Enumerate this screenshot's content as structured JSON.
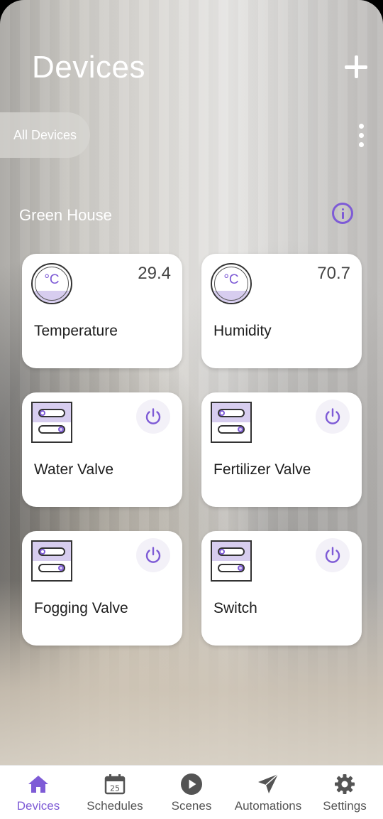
{
  "header": {
    "title": "Devices"
  },
  "filter": {
    "chip_label": "All Devices"
  },
  "section": {
    "title": "Green House"
  },
  "devices": [
    {
      "label": "Temperature",
      "value": "29.4",
      "icon": "temperature-icon",
      "unit_glyph": "°C"
    },
    {
      "label": "Humidity",
      "value": "70.7",
      "icon": "temperature-icon",
      "unit_glyph": "°C"
    },
    {
      "label": "Water Valve",
      "icon": "valve-icon"
    },
    {
      "label": "Fertilizer Valve",
      "icon": "valve-icon"
    },
    {
      "label": "Fogging Valve",
      "icon": "valve-icon"
    },
    {
      "label": "Switch",
      "icon": "valve-icon"
    }
  ],
  "nav": {
    "items": [
      {
        "label": "Devices",
        "icon": "home-icon",
        "active": true
      },
      {
        "label": "Schedules",
        "icon": "calendar-icon",
        "calendar_day": "25"
      },
      {
        "label": "Scenes",
        "icon": "play-icon"
      },
      {
        "label": "Automations",
        "icon": "send-icon"
      },
      {
        "label": "Settings",
        "icon": "gear-icon"
      }
    ]
  },
  "colors": {
    "accent": "#7e5bd6",
    "accent_light": "#d7cdef",
    "card_bg": "#ffffff",
    "nav_text": "#545454"
  }
}
